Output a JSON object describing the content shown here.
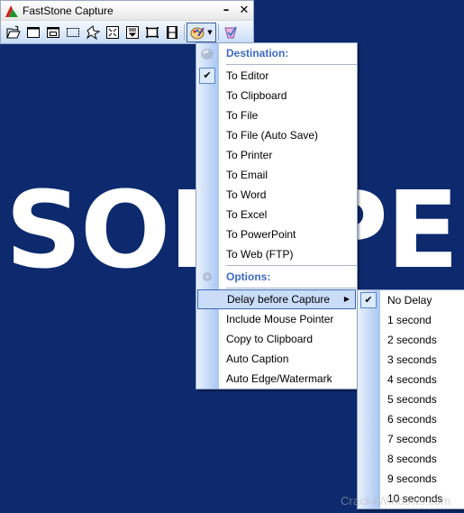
{
  "background": {
    "word": "SOFTPE",
    "watermark": "Crack4Windows.com",
    "color": "#0d2a6e"
  },
  "window": {
    "title": "FastStone Capture",
    "minimize_label": "–",
    "close_label": "✕",
    "toolbar": [
      {
        "name": "open-file",
        "tooltip": "Open"
      },
      {
        "name": "capture-active-window"
      },
      {
        "name": "capture-window-object"
      },
      {
        "name": "capture-rectangular-region"
      },
      {
        "name": "capture-freehand-region"
      },
      {
        "name": "capture-full-screen"
      },
      {
        "name": "capture-scrolling-window"
      },
      {
        "name": "capture-fixed-region"
      },
      {
        "name": "screen-recorder"
      },
      {
        "name": "output-destination"
      },
      {
        "name": "settings"
      }
    ]
  },
  "menu": {
    "destination_header": "Destination:",
    "destinations": [
      {
        "label": "To Editor",
        "checked": true
      },
      {
        "label": "To Clipboard",
        "checked": false
      },
      {
        "label": "To File",
        "checked": false
      },
      {
        "label": "To File (Auto Save)",
        "checked": false
      },
      {
        "label": "To Printer",
        "checked": false
      },
      {
        "label": "To Email",
        "checked": false
      },
      {
        "label": "To Word",
        "checked": false
      },
      {
        "label": "To Excel",
        "checked": false
      },
      {
        "label": "To PowerPoint",
        "checked": false
      },
      {
        "label": "To Web (FTP)",
        "checked": false
      }
    ],
    "options_header": "Options:",
    "options": [
      {
        "label": "Delay before Capture",
        "submenu": true,
        "highlighted": true
      },
      {
        "label": "Include Mouse Pointer"
      },
      {
        "label": "Copy to Clipboard"
      },
      {
        "label": "Auto Caption"
      },
      {
        "label": "Auto Edge/Watermark"
      }
    ]
  },
  "delay_submenu": {
    "items": [
      {
        "label": "No Delay",
        "checked": true
      },
      {
        "label": "1 second"
      },
      {
        "label": "2 seconds"
      },
      {
        "label": "3 seconds"
      },
      {
        "label": "4 seconds"
      },
      {
        "label": "5 seconds"
      },
      {
        "label": "6 seconds"
      },
      {
        "label": "7 seconds"
      },
      {
        "label": "8 seconds"
      },
      {
        "label": "9 seconds"
      },
      {
        "label": "10 seconds"
      }
    ]
  }
}
